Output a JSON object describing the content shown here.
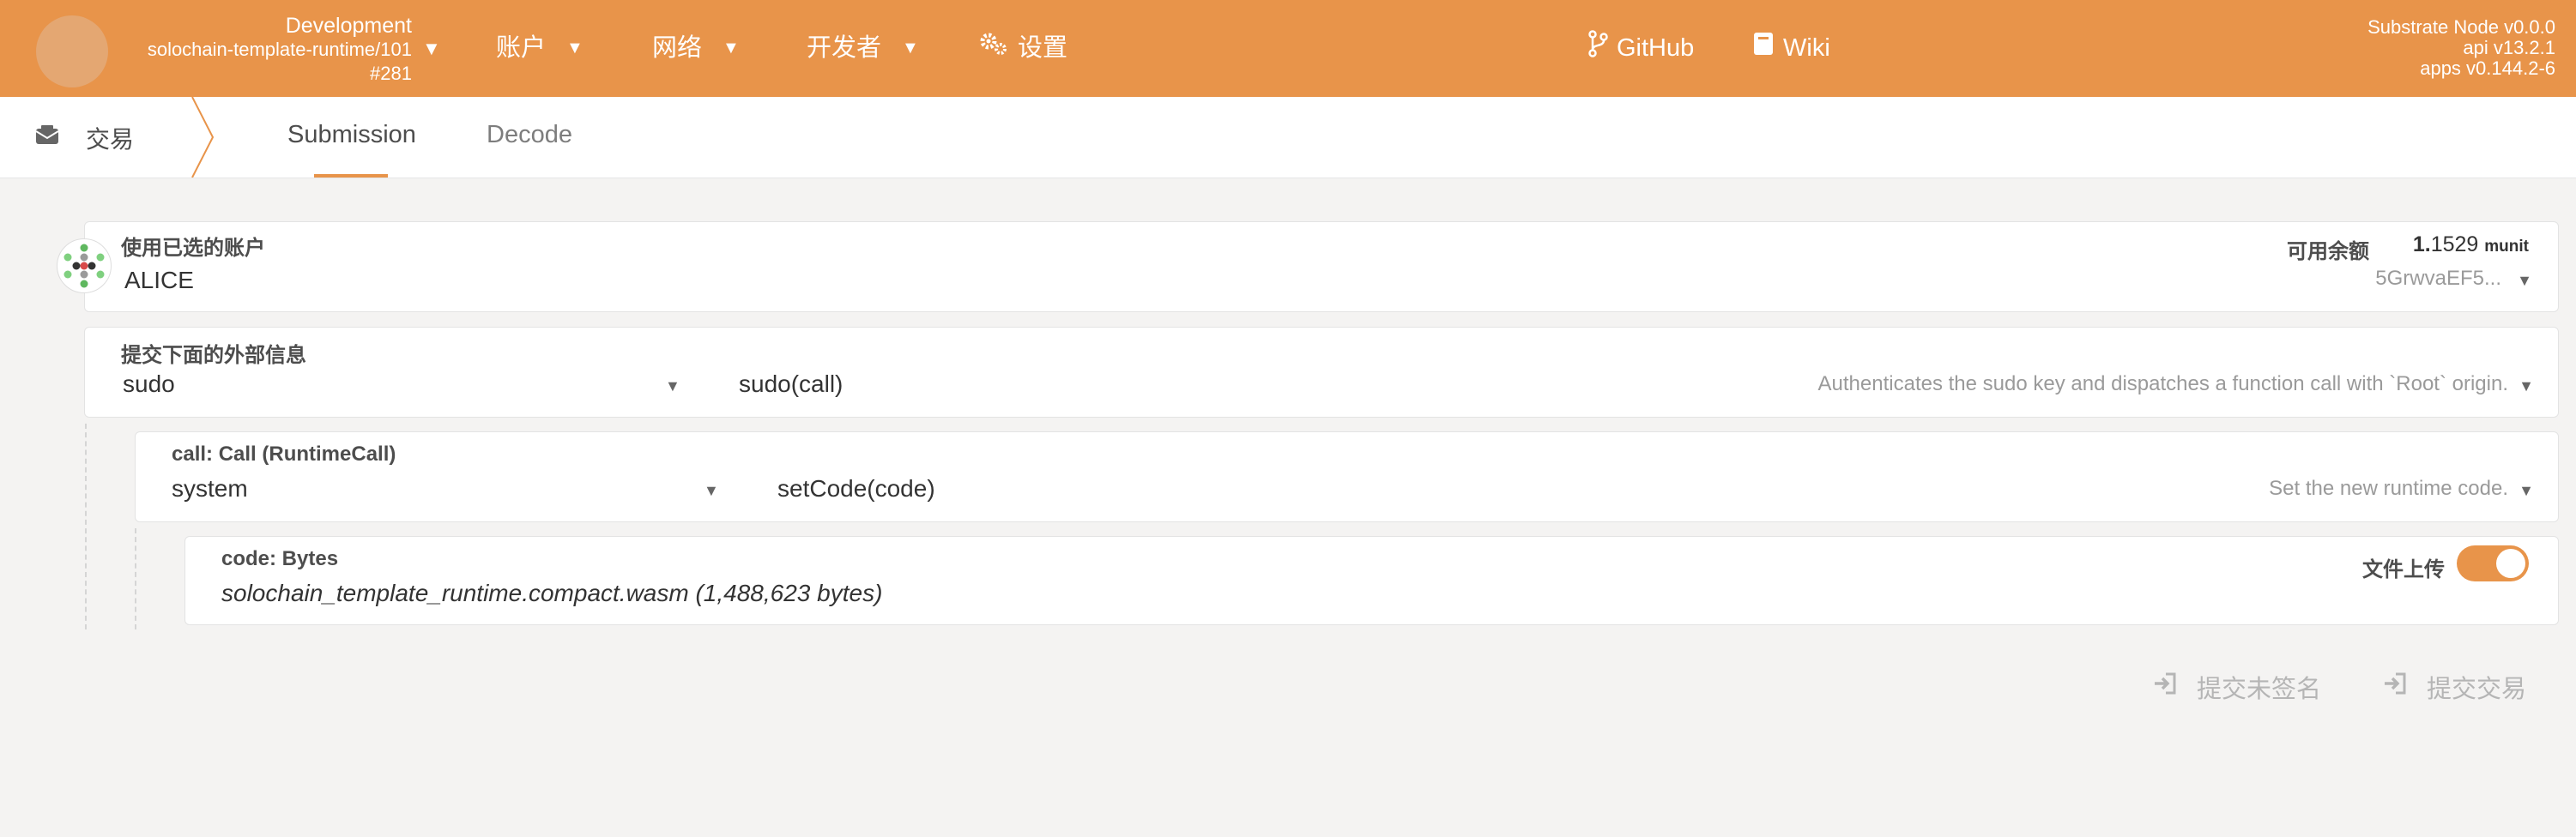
{
  "header": {
    "chain_env": "Development",
    "chain_runtime": "solochain-template-runtime/101",
    "block": "#281",
    "nav": {
      "accounts": "账户",
      "network": "网络",
      "developer": "开发者",
      "settings": "设置",
      "github": "GitHub",
      "wiki": "Wiki"
    },
    "version": {
      "node": "Substrate Node v0.0.0",
      "api": "api v13.2.1",
      "apps": "apps v0.144.2-6"
    }
  },
  "subnav": {
    "section": "交易",
    "tabs": [
      "Submission",
      "Decode"
    ],
    "active_tab": "Submission"
  },
  "account": {
    "label": "使用已选的账户",
    "name": "ALICE",
    "balance_label": "可用余额",
    "balance_int": "1.",
    "balance_dec": "1529",
    "balance_unit": "munit",
    "address": "5GrwvaEF5..."
  },
  "extrinsic": {
    "label": "提交下面的外部信息",
    "pallet": "sudo",
    "method": "sudo(call)",
    "description": "Authenticates the sudo key and dispatches a function call with `Root` origin."
  },
  "call": {
    "label": "call: Call (RuntimeCall)",
    "pallet": "system",
    "method": "setCode(code)",
    "description": "Set the new runtime code."
  },
  "code": {
    "label": "code: Bytes",
    "value": "solochain_template_runtime.compact.wasm (1,488,623 bytes)",
    "upload_label": "文件上传",
    "upload_enabled": true
  },
  "actions": {
    "submit_unsigned": "提交未签名",
    "submit": "提交交易"
  },
  "colors": {
    "accent": "#e8944a",
    "background": "#f4f3f2"
  }
}
